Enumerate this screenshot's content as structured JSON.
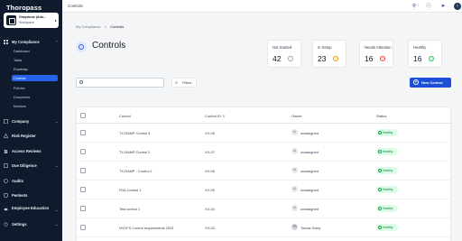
{
  "app": {
    "logo": "Thoropass"
  },
  "workspace": {
    "name": "Graystone (Adu...",
    "sub": "Workspace"
  },
  "topbar": {
    "title": "Controls",
    "avatar_initial": "T"
  },
  "sidebar": {
    "my_compliance": "My Compliance",
    "sub_items": [
      "Dashboard",
      "Tasks",
      "Roadmap",
      "Controls",
      "Policies",
      "Documents",
      "Monitors"
    ],
    "sections": [
      "Company",
      "Risk Register",
      "Access Reviews",
      "Due Diligence",
      "Audits",
      "Pentests",
      "Employee Education",
      "Settings"
    ]
  },
  "breadcrumb": {
    "parent": "My Compliance",
    "sep": ">",
    "current": "Controls"
  },
  "page": {
    "title": "Controls"
  },
  "stats": [
    {
      "label": "Not Started",
      "value": "42",
      "color": "#9ca3af"
    },
    {
      "label": "In Setup",
      "value": "23",
      "color": "#f59e0b"
    },
    {
      "label": "Needs Attention",
      "value": "16",
      "color": "#ef4444"
    },
    {
      "label": "Healthy",
      "value": "16",
      "color": "#22c55e"
    }
  ],
  "filters": {
    "label": "Filters",
    "search_placeholder": ""
  },
  "new_control": {
    "label": "New Control"
  },
  "table": {
    "headers": {
      "control": "Control",
      "control_id": "Control ID",
      "owner": "Owner",
      "status": "Status"
    },
    "rows": [
      {
        "control": "TX-RAMP Control 3",
        "id": "XX-08",
        "owner_initial": "U",
        "owner": "unassigned",
        "status": "Healthy"
      },
      {
        "control": "TX-RAMP Control 2",
        "id": "XX-07",
        "owner_initial": "U",
        "owner": "unassigned",
        "status": "Healthy"
      },
      {
        "control": "TX-RAMP - Control 1",
        "id": "XX-06",
        "owner_initial": "U",
        "owner": "unassigned",
        "status": "Healthy"
      },
      {
        "control": "FDA Control 1",
        "id": "XX-05",
        "owner_initial": "U",
        "owner": "unassigned",
        "status": "Healthy"
      },
      {
        "control": "Test control 1",
        "id": "XX-04",
        "owner_initial": "U",
        "owner": "unassigned",
        "status": "Healthy"
      },
      {
        "control": "NYDFS Control requirements 2023",
        "id": "XX-03",
        "owner_initial": "TS",
        "owner": "Tomas Soley",
        "status": "Healthy"
      }
    ]
  }
}
